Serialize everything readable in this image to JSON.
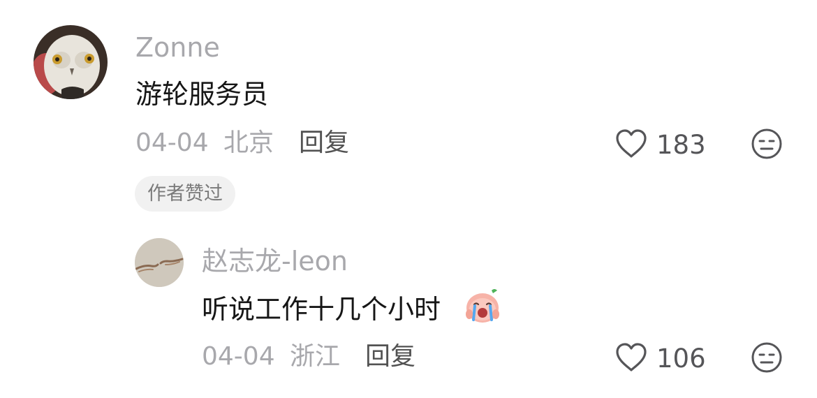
{
  "comment": {
    "username": "Zonne",
    "text": "游轮服务员",
    "date": "04-04",
    "location": "北京",
    "reply_label": "回复",
    "like_count": "183",
    "author_badge": "作者赞过"
  },
  "reply": {
    "username": "赵志龙-leon",
    "text": "听说工作十几个小时",
    "emoji": "crying-peach-emoji",
    "date": "04-04",
    "location": "浙江",
    "reply_label": "回复",
    "like_count": "106"
  },
  "icons": {
    "like": "heart-outline-icon",
    "dislike": "neutral-face-icon"
  },
  "colors": {
    "muted_text": "#a8a8ac",
    "body_text": "#161616",
    "reply_text": "#525252",
    "badge_bg": "#f1f1f1"
  }
}
